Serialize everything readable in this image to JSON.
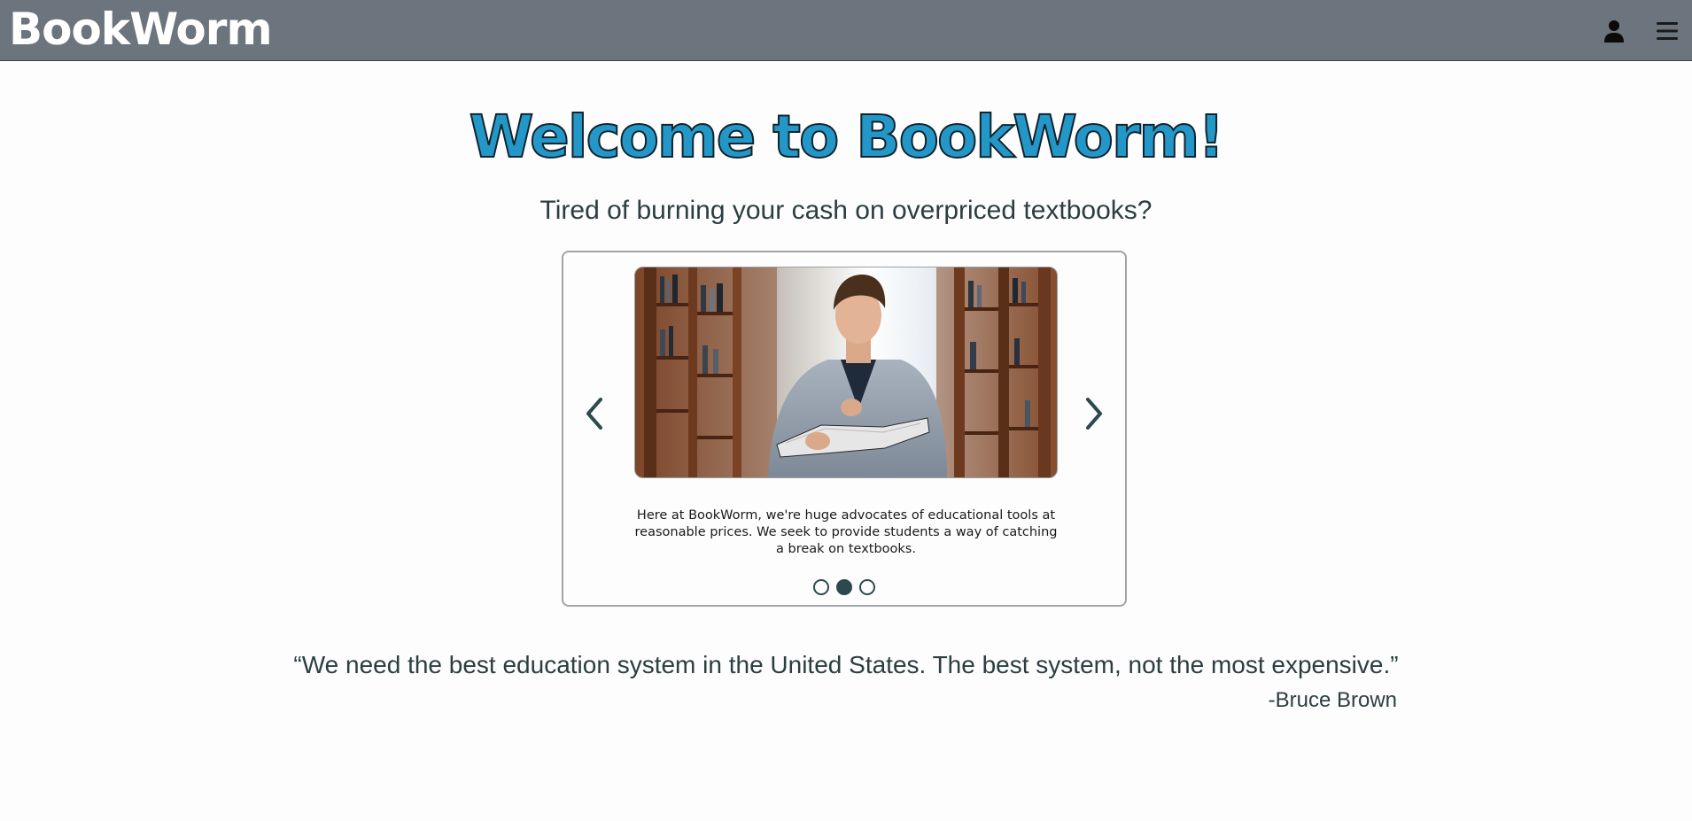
{
  "header": {
    "brand": "BookWorm",
    "icons": [
      "user-icon",
      "hamburger-menu-icon"
    ]
  },
  "hero": {
    "title": "Welcome to BookWorm!",
    "subtitle": "Tired of burning your cash on overpriced textbooks?"
  },
  "carousel": {
    "caption": "Here at BookWorm, we're huge advocates of educational tools at reasonable prices. We seek to provide students a way of catching a break on textbooks.",
    "slide_count": 3,
    "active_slide": 2,
    "prev_icon": "chevron-left-icon",
    "next_icon": "chevron-right-icon"
  },
  "quote": {
    "text": "“We need the best education system in the United States. The best system, not the most expensive.”",
    "author": "-Bruce Brown"
  },
  "colors": {
    "header_bg": "#6c757d",
    "brand_text": "#ffffff",
    "title": "#2497c9",
    "title_outline": "#10242c",
    "body_text": "#2c3e40",
    "carousel_control": "#2c4a4c"
  }
}
